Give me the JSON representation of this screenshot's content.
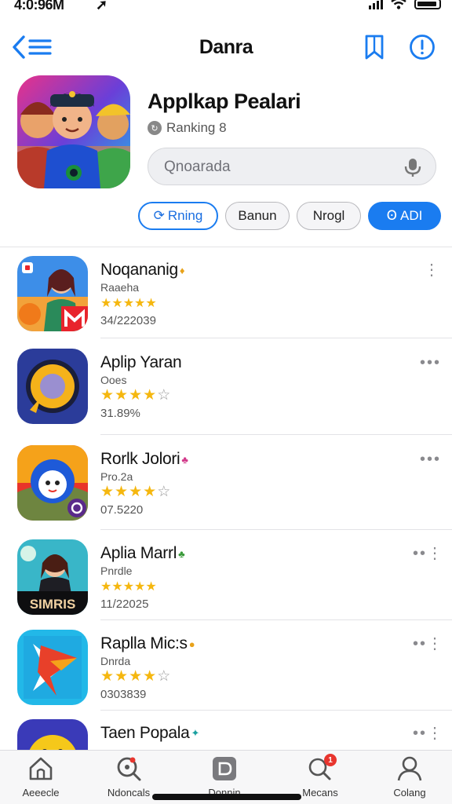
{
  "status_bar": {
    "time": "4:0:96M",
    "nav_glyph": "➚"
  },
  "nav": {
    "title": "Danra",
    "back_icon": "chevron-left-list-icon",
    "bookmark_icon": "bookmark-icon",
    "info_icon": "info-icon"
  },
  "hero": {
    "title": "Applkap Pealari",
    "rank_label": "Ranking 8",
    "search_placeholder": "Qnoarada"
  },
  "chips": [
    {
      "label": "Rning",
      "icon": "⟳"
    },
    {
      "label": "Banun"
    },
    {
      "label": "Nrogl"
    },
    {
      "label": "ADI",
      "icon": "Ꙩ"
    }
  ],
  "apps": [
    {
      "name": "Noqananig",
      "badge": "♦",
      "sub": "Raaeha",
      "stars": 5,
      "max": 5,
      "small_stars": true,
      "meta": "34/222039",
      "more": "⋮"
    },
    {
      "name": "Aplip Yaran",
      "badge": "",
      "sub": "Ooes",
      "stars": 4,
      "max": 5,
      "small_stars": false,
      "meta": "31.89%",
      "more": "•••"
    },
    {
      "name": "Rorlk Jolori",
      "badge": "♣",
      "sub": "Pro.2a",
      "stars": 4,
      "max": 5,
      "small_stars": false,
      "meta": "07.5220",
      "more": "•••"
    },
    {
      "name": "Aplia Marrl",
      "badge": "♣",
      "sub": "Pnrdle",
      "stars": 5,
      "max": 5,
      "small_stars": true,
      "meta": "11/22025",
      "more": "••⋮"
    },
    {
      "name": "Raplla Mic:s",
      "badge": "●",
      "sub": "Dnrda",
      "stars": 4,
      "max": 5,
      "small_stars": false,
      "meta": "0303839",
      "more": "••⋮"
    },
    {
      "name": "Taen Popala",
      "badge": "✦",
      "sub": "",
      "stars": 0,
      "max": 0,
      "small_stars": false,
      "meta": "",
      "more": "••⋮"
    }
  ],
  "tabbar": [
    {
      "label": "Aeeecle",
      "icon": "home-icon"
    },
    {
      "label": "Ndoncals",
      "icon": "search-icon"
    },
    {
      "label": "Donnin",
      "icon": "apps-icon"
    },
    {
      "label": "Mecans",
      "icon": "chat-search-icon",
      "badge": "1"
    },
    {
      "label": "Colang",
      "icon": "profile-icon"
    }
  ],
  "colors": {
    "accent": "#1a7cf0",
    "star": "#f5b70f",
    "badge_red": "#e8352e"
  }
}
